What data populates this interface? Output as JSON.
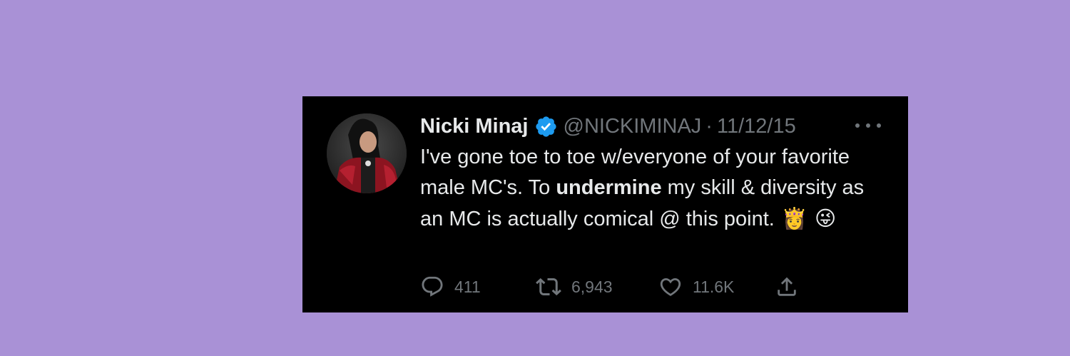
{
  "tweet": {
    "display_name": "Nicki Minaj",
    "handle": "@NICKIMINAJ",
    "separator": "·",
    "date": "11/12/15",
    "text_part1": "I've gone toe to toe w/everyone of your favorite male MC's. To ",
    "text_bold": "undermine",
    "text_part2": " my skill & diversity as an MC is actually comical @ this point.",
    "emoji_1": "👸",
    "emoji_2": "😜",
    "avatar_icon": "profile-photo",
    "verified_icon": "verified-badge-icon",
    "verified_color": "#1d9bf0"
  },
  "stats": {
    "replies": "411",
    "retweets": "6,943",
    "likes": "11.6K"
  },
  "colors": {
    "background": "#a991d6",
    "card": "#000000",
    "text": "#e7e9ea",
    "muted": "#71767b"
  }
}
